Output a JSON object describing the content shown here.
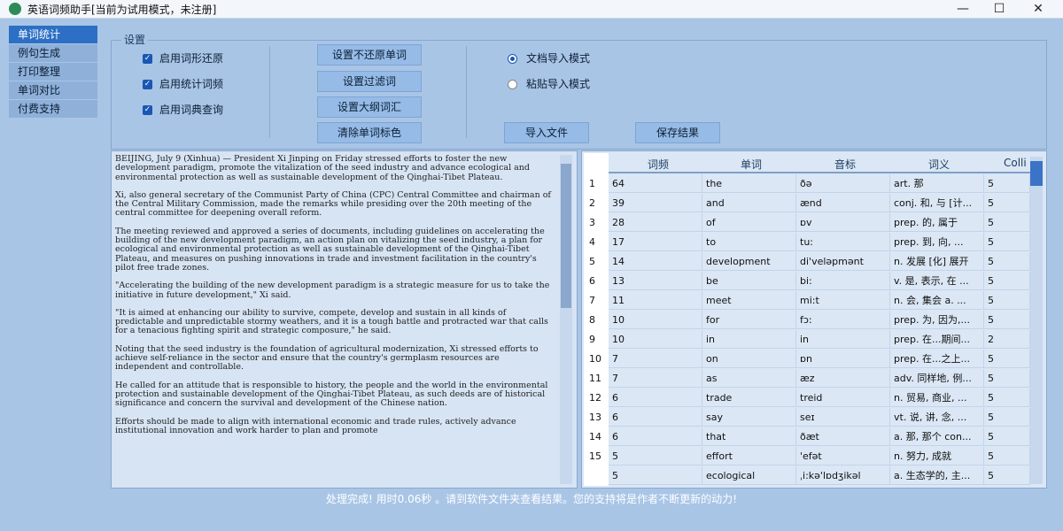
{
  "window": {
    "title": "英语词频助手[当前为试用模式，未注册]",
    "min": "—",
    "max": "☐",
    "close": "✕"
  },
  "sidebar": {
    "items": [
      {
        "label": "单词统计",
        "active": true
      },
      {
        "label": "例句生成"
      },
      {
        "label": "打印整理"
      },
      {
        "label": "单词对比"
      },
      {
        "label": "付费支持"
      }
    ]
  },
  "settings": {
    "legend": "设置",
    "checks": [
      {
        "label": "启用词形还原",
        "checked": true
      },
      {
        "label": "启用统计词频",
        "checked": true
      },
      {
        "label": "启用词典查询",
        "checked": true
      }
    ],
    "buttons": [
      "设置不还原单词",
      "设置过滤词",
      "设置大纲词汇",
      "清除单词标色"
    ],
    "radios": [
      {
        "label": "文档导入模式",
        "selected": true
      },
      {
        "label": "粘贴导入模式",
        "selected": false
      }
    ],
    "import_btn": "导入文件",
    "save_btn": "保存结果"
  },
  "document": {
    "paragraphs": [
      "BEIJING, July 9 (Xinhua) — President Xi Jinping on Friday stressed efforts to foster the new development paradigm, promote the vitalization of the seed industry and advance ecological and environmental protection as well as sustainable development of the Qinghai-Tibet Plateau.",
      "Xi, also general secretary of the Communist Party of China (CPC) Central Committee and chairman of the Central Military Commission, made the remarks while presiding over the 20th meeting of the central committee for deepening overall reform.",
      "The meeting reviewed and approved a series of documents, including guidelines on accelerating the building of the new development paradigm, an action plan on vitalizing the seed industry, a plan for ecological and environmental protection as well as sustainable development of the Qinghai-Tibet Plateau, and measures on pushing innovations in trade and investment facilitation in the country's pilot free trade zones.",
      "\"Accelerating the building of the new development paradigm is a strategic measure for us to take the initiative in future development,\" Xi said.",
      "\"It is aimed at enhancing our ability to survive, compete, develop and sustain in all kinds of predictable and unpredictable stormy weathers, and it is a tough battle and protracted war that calls for a tenacious fighting spirit and strategic composure,\" he said.",
      "Noting that the seed industry is the foundation of agricultural modernization, Xi stressed efforts to achieve self-reliance in the sector and ensure that the country's germplasm resources are independent and controllable.",
      "He called for an attitude that is responsible to history, the people and the world in the environmental protection and sustainable development of the Qinghai-Tibet Plateau, as such deeds are of historical significance and concern the survival and development of the Chinese nation.",
      "Efforts should be made to align with international economic and trade rules, actively advance institutional innovation and work harder to plan and promote"
    ]
  },
  "table": {
    "headers": [
      "词频",
      "单词",
      "音标",
      "词义",
      "Colli"
    ],
    "rows": [
      {
        "num": "1",
        "freq": "64",
        "word": "the",
        "phon": "ðə",
        "mean": "art. 那",
        "coll": "5"
      },
      {
        "num": "2",
        "freq": "39",
        "word": "and",
        "phon": "ænd",
        "mean": "conj. 和, 与 [计...",
        "coll": "5"
      },
      {
        "num": "3",
        "freq": "28",
        "word": "of",
        "phon": "ɒv",
        "mean": "prep. 的, 属于",
        "coll": "5"
      },
      {
        "num": "4",
        "freq": "17",
        "word": "to",
        "phon": "tu:",
        "mean": "prep. 到, 向, ...",
        "coll": "5"
      },
      {
        "num": "5",
        "freq": "14",
        "word": "development",
        "phon": "di'veləpmənt",
        "mean": "n. 发展 [化] 展开",
        "coll": "5"
      },
      {
        "num": "6",
        "freq": "13",
        "word": "be",
        "phon": "bi:",
        "mean": "v. 是, 表示, 在 ...",
        "coll": "5"
      },
      {
        "num": "7",
        "freq": "11",
        "word": "meet",
        "phon": "mi:t",
        "mean": "n. 会, 集会 a. ...",
        "coll": "5"
      },
      {
        "num": "8",
        "freq": "10",
        "word": "for",
        "phon": "fɔ:",
        "mean": "prep. 为, 因为,...",
        "coll": "5"
      },
      {
        "num": "9",
        "freq": "10",
        "word": "in",
        "phon": "in",
        "mean": "prep. 在...期间...",
        "coll": "2"
      },
      {
        "num": "10",
        "freq": "7",
        "word": "on",
        "phon": "ɒn",
        "mean": "prep. 在...之上...",
        "coll": "5"
      },
      {
        "num": "11",
        "freq": "7",
        "word": "as",
        "phon": "æz",
        "mean": "adv. 同样地, 例...",
        "coll": "5"
      },
      {
        "num": "12",
        "freq": "6",
        "word": "trade",
        "phon": "treid",
        "mean": "n. 贸易, 商业, ...",
        "coll": "5"
      },
      {
        "num": "13",
        "freq": "6",
        "word": "say",
        "phon": "seɪ",
        "mean": "vt. 说, 讲, 念, ...",
        "coll": "5"
      },
      {
        "num": "14",
        "freq": "6",
        "word": "that",
        "phon": "ðæt",
        "mean": "a. 那, 那个 con...",
        "coll": "5"
      },
      {
        "num": "15",
        "freq": "5",
        "word": "effort",
        "phon": "'efət",
        "mean": "n. 努力, 成就",
        "coll": "5"
      },
      {
        "num": "",
        "freq": "5",
        "word": "ecological",
        "phon": "ˌi:kə'lɒdʒikəl",
        "mean": "a. 生态学的, 主...",
        "coll": "5"
      }
    ]
  },
  "status": "处理完成! 用时0.06秒 。请到软件文件夹查看结果。您的支持将是作者不断更新的动力!"
}
